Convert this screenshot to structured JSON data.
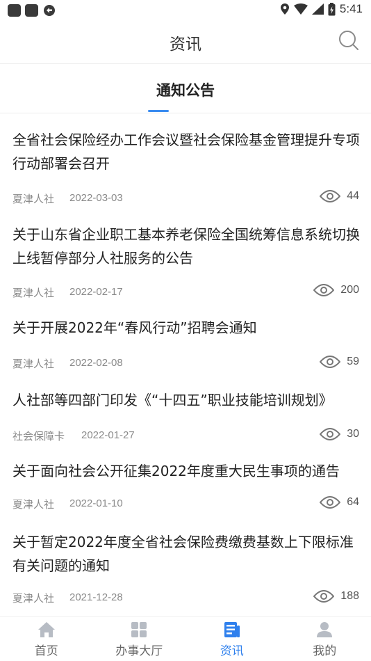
{
  "status_bar": {
    "time": "5:41",
    "icons": [
      "notification-square-icon",
      "notification-square-icon",
      "sync-icon",
      "location-icon",
      "wifi-icon",
      "signal-icon",
      "battery-icon"
    ]
  },
  "header": {
    "title": "资讯",
    "search_icon": "search-icon"
  },
  "tabs": [
    {
      "label": "通知公告",
      "active": true
    }
  ],
  "news": [
    {
      "title": "全省社会保险经办工作会议暨社会保险基金管理提升专项行动部署会召开",
      "source": "夏津人社",
      "date": "2022-03-03",
      "views": "44"
    },
    {
      "title": "关于山东省企业职工基本养老保险全国统筹信息系统切换上线暂停部分人社服务的公告",
      "source": "夏津人社",
      "date": "2022-02-17",
      "views": "200"
    },
    {
      "title": "关于开展2022年“春风行动”招聘会通知",
      "source": "夏津人社",
      "date": "2022-02-08",
      "views": "59"
    },
    {
      "title": "人社部等四部门印发《“十四五”职业技能培训规划》",
      "source": "社会保障卡",
      "date": "2022-01-27",
      "views": "30"
    },
    {
      "title": "关于面向社会公开征集2022年度重大民生事项的通告",
      "source": "夏津人社",
      "date": "2022-01-10",
      "views": "64"
    },
    {
      "title": "关于暂定2022年度全省社会保险费缴费基数上下限标准有关问题的通知",
      "source": "夏津人社",
      "date": "2021-12-28",
      "views": "188"
    }
  ],
  "bottom_nav": [
    {
      "label": "首页",
      "icon": "home-icon",
      "active": false
    },
    {
      "label": "办事大厅",
      "icon": "grid-icon",
      "active": false
    },
    {
      "label": "资讯",
      "icon": "news-icon",
      "active": true
    },
    {
      "label": "我的",
      "icon": "user-icon",
      "active": false
    }
  ],
  "colors": {
    "accent": "#2f80ed",
    "text": "#222222",
    "meta": "#8a8a8a",
    "nav_inactive": "#b7bcc4"
  }
}
